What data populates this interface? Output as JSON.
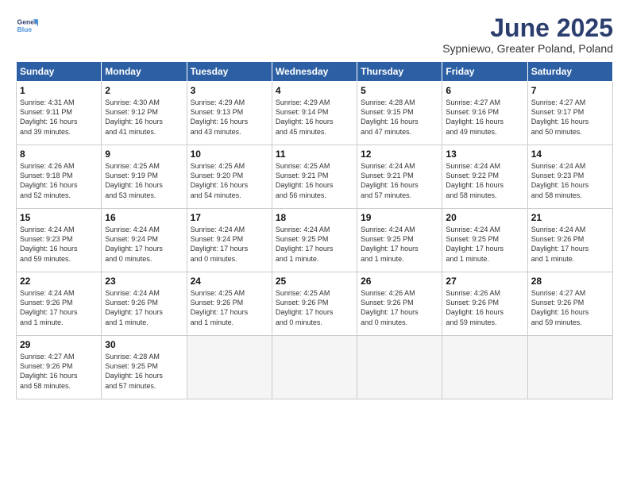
{
  "header": {
    "logo_line1": "General",
    "logo_line2": "Blue",
    "month": "June 2025",
    "location": "Sypniewo, Greater Poland, Poland"
  },
  "days_of_week": [
    "Sunday",
    "Monday",
    "Tuesday",
    "Wednesday",
    "Thursday",
    "Friday",
    "Saturday"
  ],
  "weeks": [
    [
      {
        "day": "1",
        "lines": [
          "Sunrise: 4:31 AM",
          "Sunset: 9:11 PM",
          "Daylight: 16 hours",
          "and 39 minutes."
        ]
      },
      {
        "day": "2",
        "lines": [
          "Sunrise: 4:30 AM",
          "Sunset: 9:12 PM",
          "Daylight: 16 hours",
          "and 41 minutes."
        ]
      },
      {
        "day": "3",
        "lines": [
          "Sunrise: 4:29 AM",
          "Sunset: 9:13 PM",
          "Daylight: 16 hours",
          "and 43 minutes."
        ]
      },
      {
        "day": "4",
        "lines": [
          "Sunrise: 4:29 AM",
          "Sunset: 9:14 PM",
          "Daylight: 16 hours",
          "and 45 minutes."
        ]
      },
      {
        "day": "5",
        "lines": [
          "Sunrise: 4:28 AM",
          "Sunset: 9:15 PM",
          "Daylight: 16 hours",
          "and 47 minutes."
        ]
      },
      {
        "day": "6",
        "lines": [
          "Sunrise: 4:27 AM",
          "Sunset: 9:16 PM",
          "Daylight: 16 hours",
          "and 49 minutes."
        ]
      },
      {
        "day": "7",
        "lines": [
          "Sunrise: 4:27 AM",
          "Sunset: 9:17 PM",
          "Daylight: 16 hours",
          "and 50 minutes."
        ]
      }
    ],
    [
      {
        "day": "8",
        "lines": [
          "Sunrise: 4:26 AM",
          "Sunset: 9:18 PM",
          "Daylight: 16 hours",
          "and 52 minutes."
        ]
      },
      {
        "day": "9",
        "lines": [
          "Sunrise: 4:25 AM",
          "Sunset: 9:19 PM",
          "Daylight: 16 hours",
          "and 53 minutes."
        ]
      },
      {
        "day": "10",
        "lines": [
          "Sunrise: 4:25 AM",
          "Sunset: 9:20 PM",
          "Daylight: 16 hours",
          "and 54 minutes."
        ]
      },
      {
        "day": "11",
        "lines": [
          "Sunrise: 4:25 AM",
          "Sunset: 9:21 PM",
          "Daylight: 16 hours",
          "and 56 minutes."
        ]
      },
      {
        "day": "12",
        "lines": [
          "Sunrise: 4:24 AM",
          "Sunset: 9:21 PM",
          "Daylight: 16 hours",
          "and 57 minutes."
        ]
      },
      {
        "day": "13",
        "lines": [
          "Sunrise: 4:24 AM",
          "Sunset: 9:22 PM",
          "Daylight: 16 hours",
          "and 58 minutes."
        ]
      },
      {
        "day": "14",
        "lines": [
          "Sunrise: 4:24 AM",
          "Sunset: 9:23 PM",
          "Daylight: 16 hours",
          "and 58 minutes."
        ]
      }
    ],
    [
      {
        "day": "15",
        "lines": [
          "Sunrise: 4:24 AM",
          "Sunset: 9:23 PM",
          "Daylight: 16 hours",
          "and 59 minutes."
        ]
      },
      {
        "day": "16",
        "lines": [
          "Sunrise: 4:24 AM",
          "Sunset: 9:24 PM",
          "Daylight: 17 hours",
          "and 0 minutes."
        ]
      },
      {
        "day": "17",
        "lines": [
          "Sunrise: 4:24 AM",
          "Sunset: 9:24 PM",
          "Daylight: 17 hours",
          "and 0 minutes."
        ]
      },
      {
        "day": "18",
        "lines": [
          "Sunrise: 4:24 AM",
          "Sunset: 9:25 PM",
          "Daylight: 17 hours",
          "and 1 minute."
        ]
      },
      {
        "day": "19",
        "lines": [
          "Sunrise: 4:24 AM",
          "Sunset: 9:25 PM",
          "Daylight: 17 hours",
          "and 1 minute."
        ]
      },
      {
        "day": "20",
        "lines": [
          "Sunrise: 4:24 AM",
          "Sunset: 9:25 PM",
          "Daylight: 17 hours",
          "and 1 minute."
        ]
      },
      {
        "day": "21",
        "lines": [
          "Sunrise: 4:24 AM",
          "Sunset: 9:26 PM",
          "Daylight: 17 hours",
          "and 1 minute."
        ]
      }
    ],
    [
      {
        "day": "22",
        "lines": [
          "Sunrise: 4:24 AM",
          "Sunset: 9:26 PM",
          "Daylight: 17 hours",
          "and 1 minute."
        ]
      },
      {
        "day": "23",
        "lines": [
          "Sunrise: 4:24 AM",
          "Sunset: 9:26 PM",
          "Daylight: 17 hours",
          "and 1 minute."
        ]
      },
      {
        "day": "24",
        "lines": [
          "Sunrise: 4:25 AM",
          "Sunset: 9:26 PM",
          "Daylight: 17 hours",
          "and 1 minute."
        ]
      },
      {
        "day": "25",
        "lines": [
          "Sunrise: 4:25 AM",
          "Sunset: 9:26 PM",
          "Daylight: 17 hours",
          "and 0 minutes."
        ]
      },
      {
        "day": "26",
        "lines": [
          "Sunrise: 4:26 AM",
          "Sunset: 9:26 PM",
          "Daylight: 17 hours",
          "and 0 minutes."
        ]
      },
      {
        "day": "27",
        "lines": [
          "Sunrise: 4:26 AM",
          "Sunset: 9:26 PM",
          "Daylight: 16 hours",
          "and 59 minutes."
        ]
      },
      {
        "day": "28",
        "lines": [
          "Sunrise: 4:27 AM",
          "Sunset: 9:26 PM",
          "Daylight: 16 hours",
          "and 59 minutes."
        ]
      }
    ],
    [
      {
        "day": "29",
        "lines": [
          "Sunrise: 4:27 AM",
          "Sunset: 9:26 PM",
          "Daylight: 16 hours",
          "and 58 minutes."
        ]
      },
      {
        "day": "30",
        "lines": [
          "Sunrise: 4:28 AM",
          "Sunset: 9:25 PM",
          "Daylight: 16 hours",
          "and 57 minutes."
        ]
      },
      {
        "day": "",
        "lines": []
      },
      {
        "day": "",
        "lines": []
      },
      {
        "day": "",
        "lines": []
      },
      {
        "day": "",
        "lines": []
      },
      {
        "day": "",
        "lines": []
      }
    ]
  ]
}
